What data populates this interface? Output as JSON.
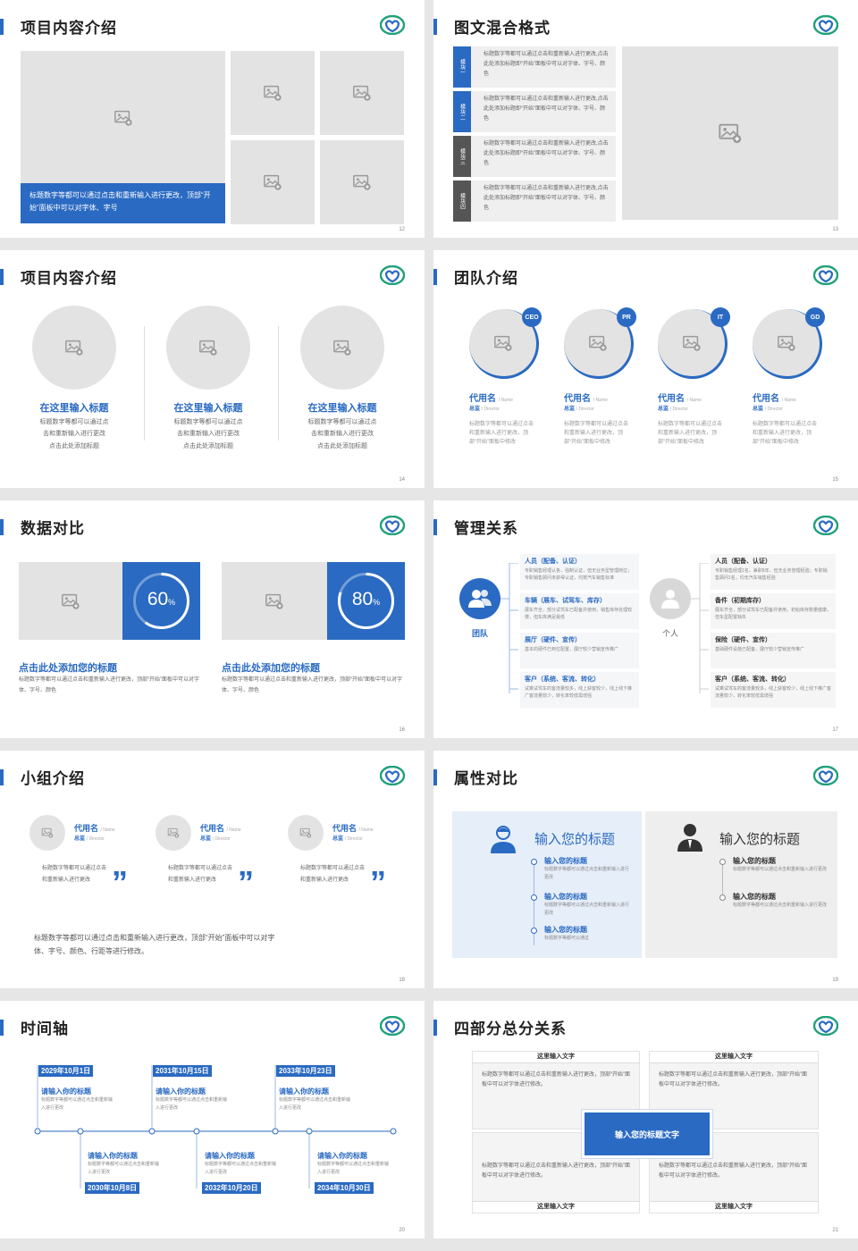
{
  "colors": {
    "accent": "#2a6ac2",
    "logo_green": "#1fa07a",
    "placeholder": "#e3e3e3"
  },
  "slides": {
    "s12": {
      "title": "项目内容介绍",
      "caption": "标题数字等都可以通过点击和重新输入进行更改，顶部“开始”面板中可以对字体、字号",
      "page": "12"
    },
    "s13": {
      "title": "图文混合格式",
      "page": "13",
      "items": [
        {
          "tag": "模块一",
          "text": "标题数字等都可以通过点击和重新输入进行更改,点击此处添加标题即“开始”面板中可以对字体、字号、颜色"
        },
        {
          "tag": "模块二",
          "text": "标题数字等都可以通过点击和重新输入进行更改,点击此处添加标题即“开始”面板中可以对字体、字号、颜色"
        },
        {
          "tag": "模块三",
          "text": "标题数字等都可以通过点击和重新输入进行更改,点击此处添加标题即“开始”面板中可以对字体、字号、颜色"
        },
        {
          "tag": "模块四",
          "text": "标题数字等都可以通过点击和重新输入进行更改,点击此处添加标题即“开始”面板中可以对字体、字号、颜色"
        }
      ]
    },
    "s14": {
      "title": "项目内容介绍",
      "page": "14",
      "cols": [
        {
          "heading": "在这里输入标题",
          "l1": "标题数字等都可以通过点",
          "l2": "击和重新输入进行更改",
          "l3": "点击此处添加标题"
        },
        {
          "heading": "在这里输入标题",
          "l1": "标题数字等都可以通过点",
          "l2": "击和重新输入进行更改",
          "l3": "点击此处添加标题"
        },
        {
          "heading": "在这里输入标题",
          "l1": "标题数字等都可以通过点",
          "l2": "击和重新输入进行更改",
          "l3": "点击此处添加标题"
        }
      ]
    },
    "s15": {
      "title": "团队介绍",
      "page": "15",
      "members": [
        {
          "badge": "CEO",
          "name": "代用名",
          "name_en": "/ Name",
          "role": "总监",
          "role_en": "/ Director",
          "desc": "标题数字等都可以通过点击和重新输入进行更改，顶部“开始”面板中修改"
        },
        {
          "badge": "PR",
          "name": "代用名",
          "name_en": "/ Name",
          "role": "总监",
          "role_en": "/ Director",
          "desc": "标题数字等都可以通过点击和重新输入进行更改，顶部“开始”面板中修改"
        },
        {
          "badge": "IT",
          "name": "代用名",
          "name_en": "/ Name",
          "role": "总监",
          "role_en": "/ Director",
          "desc": "标题数字等都可以通过点击和重新输入进行更改，顶部“开始”面板中修改"
        },
        {
          "badge": "GD",
          "name": "代用名",
          "name_en": "/ Name",
          "role": "总监",
          "role_en": "/ Director",
          "desc": "标题数字等都可以通过点击和重新输入进行更改，顶部“开始”面板中修改"
        }
      ]
    },
    "s16": {
      "title": "数据对比",
      "page": "16",
      "cards": [
        {
          "value": "60",
          "unit": "%",
          "fraction": 0.6,
          "heading": "点击此处添加您的标题",
          "desc": "标题数字等都可以通过点击和重新输入进行更改，顶部“开始”面板中可以对字体、字号、颜色"
        },
        {
          "value": "80",
          "unit": "%",
          "fraction": 0.8,
          "heading": "点击此处添加您的标题",
          "desc": "标题数字等都可以通过点击和重新输入进行更改，顶部“开始”面板中可以对字体、字号、颜色"
        }
      ]
    },
    "s17": {
      "title": "管理关系",
      "page": "17",
      "left_label": "团队",
      "right_label": "个人",
      "left": [
        {
          "h": "人员（配备、认证）",
          "t": "专职销售经理认各，强制认证，但无业务型管理岗位；专职销售顾问未获得认证，均按汽车销售标准"
        },
        {
          "h": "车辆（展车、试驾车、库存）",
          "t": "展车齐全，部分试驾车已配备并使用，销售库存处理较慢，但车库满足最低"
        },
        {
          "h": "展厅（硬件、宣传）",
          "t": "基本的硬件已到位配置，展厅较少营销宣传推广"
        },
        {
          "h": "客户（系统、客流、转化）",
          "t": "试乘试驾车的客流量较多，线上获客较少，线上线下推广客流量较少，转化率较低需增强"
        }
      ],
      "right": [
        {
          "h": "人员（配备、认证）",
          "t": "专职销售经理1名，兼职8年，但无业务管理经验；专职销售顾问1名，均无汽车销售经验"
        },
        {
          "h": "备件（初期库存）",
          "t": "展车齐全，部分试驾车已配备并使用，初始库存数量健康，但车型配置缺失"
        },
        {
          "h": "保险（硬件、宣传）",
          "t": "基础硬件设施已配备，展厅较少营销宣传推广"
        },
        {
          "h": "客户（系统、客流、转化）",
          "t": "试乘试驾车的客流量较多，线上获客较少，线上线下推广客流量较少，转化率较低需增强"
        }
      ]
    },
    "s18": {
      "title": "小组介绍",
      "page": "18",
      "members": [
        {
          "name": "代用名",
          "name_en": "/ Name",
          "role": "总监",
          "role_en": "/ Director",
          "desc": "标题数字等都可以通过点击和重新输入进行更改"
        },
        {
          "name": "代用名",
          "name_en": "/ Name",
          "role": "总监",
          "role_en": "/ Director",
          "desc": "标题数字等都可以通过点击和重新输入进行更改"
        },
        {
          "name": "代用名",
          "name_en": "/ Name",
          "role": "总监",
          "role_en": "/ Director",
          "desc": "标题数字等都可以通过点击和重新输入进行更改"
        }
      ],
      "quote": "”",
      "footer": "标题数字等都可以通过点击和重新输入进行更改，顶部“开始”面板中可以对字体、字号、颜色、行距等进行修改。"
    },
    "s19": {
      "title": "属性对比",
      "page": "19",
      "left": {
        "heading": "输入您的标题",
        "items": [
          {
            "h": "输入您的标题",
            "t": "标题数字等都可以通过点击和重新输入进行更改"
          },
          {
            "h": "输入您的标题",
            "t": "标题数字等都可以通过点击和重新输入进行更改"
          },
          {
            "h": "输入您的标题",
            "t": "标题数字等都可以通过"
          }
        ]
      },
      "right": {
        "heading": "输入您的标题",
        "items": [
          {
            "h": "输入您的标题",
            "t": "标题数字等都可以通过点击和重新输入进行更改"
          },
          {
            "h": "输入您的标题",
            "t": "标题数字等都可以通过点击和重新输入进行更改"
          }
        ]
      }
    },
    "s20": {
      "title": "时间轴",
      "page": "20",
      "top": [
        {
          "date": "2029年10月1日",
          "h": "请输入你的标题",
          "t": "标题数字等都可以通过点击和重新输入进行更改"
        },
        {
          "date": "2031年10月15日",
          "h": "请输入你的标题",
          "t": "标题数字等都可以通过点击和重新输入进行更改"
        },
        {
          "date": "2033年10月23日",
          "h": "请输入你的标题",
          "t": "标题数字等都可以通过点击和重新输入进行更改"
        }
      ],
      "bottom": [
        {
          "date": "2030年10月8日",
          "h": "请输入你的标题",
          "t": "标题数字等都可以通过点击和重新输入进行更改"
        },
        {
          "date": "2032年10月20日",
          "h": "请输入你的标题",
          "t": "标题数字等都可以通过点击和重新输入进行更改"
        },
        {
          "date": "2034年10月30日",
          "h": "请输入你的标题",
          "t": "标题数字等都可以通过点击和重新输入进行更改"
        }
      ]
    },
    "s21": {
      "title": "四部分总分关系",
      "page": "21",
      "center": "输入您的标题文字",
      "quads": [
        {
          "label": "这里输入文字",
          "t": "标题数字等都可以通过点击和重新输入进行更改，顶部“开始”面板中可以对字体进行修改。"
        },
        {
          "label": "这里输入文字",
          "t": "标题数字等都可以通过点击和重新输入进行更改，顶部“开始”面板中可以对字体进行修改。"
        },
        {
          "label": "这里输入文字",
          "t": "标题数字等都可以通过点击和重新输入进行更改，顶部“开始”面板中可以对字体进行修改。"
        },
        {
          "label": "这里输入文字",
          "t": "标题数字等都可以通过点击和重新输入进行更改，顶部“开始”面板中可以对字体进行修改。"
        }
      ]
    }
  }
}
